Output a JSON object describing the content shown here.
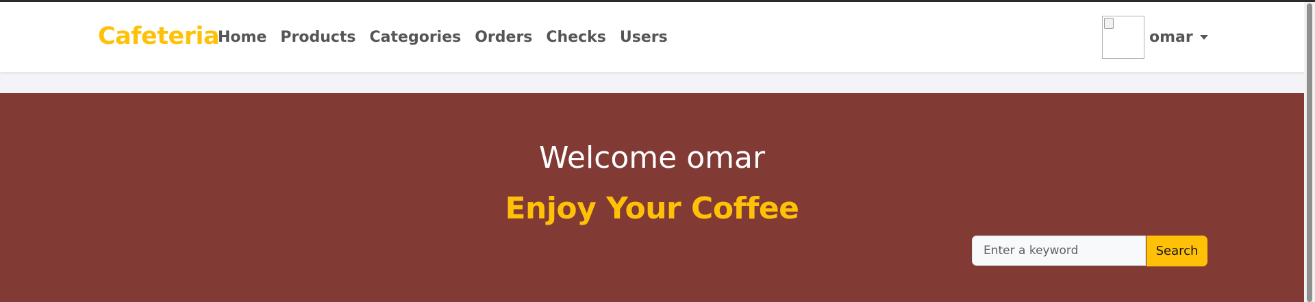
{
  "navbar": {
    "brand": "Cafeteria",
    "links": [
      "Home",
      "Products",
      "Categories",
      "Orders",
      "Checks",
      "Users"
    ],
    "user": {
      "name": "omar"
    }
  },
  "hero": {
    "welcome": "Welcome omar",
    "tagline": "Enjoy Your Coffee",
    "search": {
      "placeholder": "Enter a keyword",
      "value": "",
      "button_label": "Search"
    }
  },
  "colors": {
    "brand": "#ffc107",
    "hero_bg": "#823a35",
    "nav_text": "#555555"
  }
}
